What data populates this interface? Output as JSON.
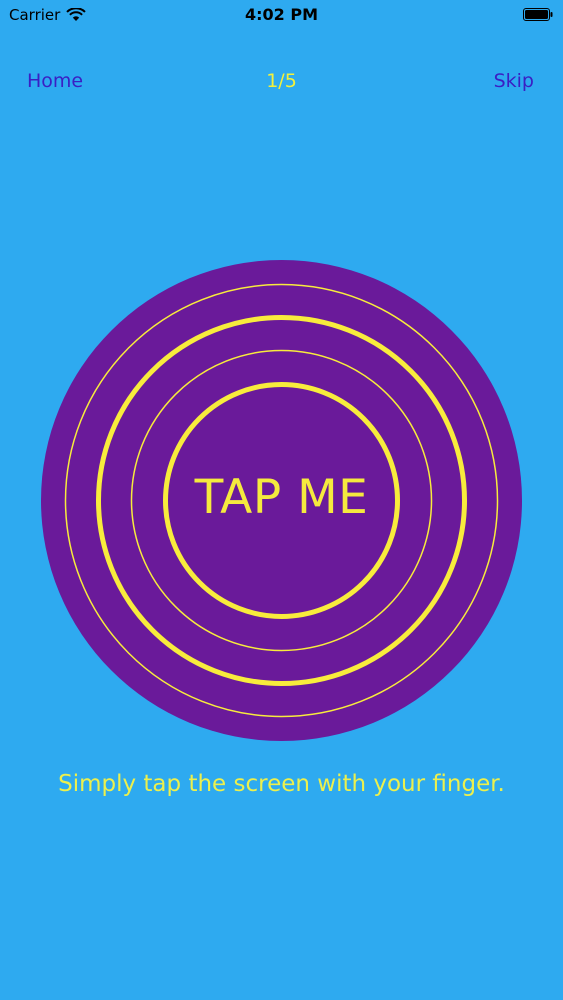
{
  "status_bar": {
    "carrier": "Carrier",
    "time": "4:02 PM",
    "wifi_icon": "wifi-icon",
    "battery_icon": "battery-full-icon"
  },
  "nav": {
    "home_label": "Home",
    "progress": "1/5",
    "skip_label": "Skip"
  },
  "target": {
    "label": "TAP ME",
    "fill_color": "#6a1a9a",
    "ring_color": "#f8ec3c"
  },
  "instruction": "Simply tap the screen with your finger.",
  "colors": {
    "background": "#2eaaf0",
    "nav_link": "#3a1fc4",
    "accent_yellow": "#f4f13a"
  }
}
